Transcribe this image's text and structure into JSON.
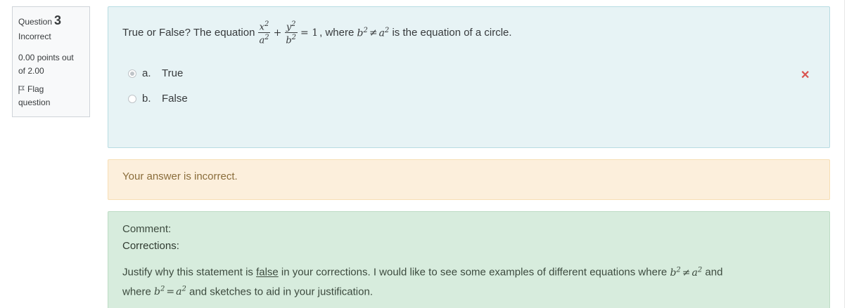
{
  "info": {
    "question_label": "Question",
    "question_number": "3",
    "state": "Incorrect",
    "grade_line1": "0.00 points out",
    "grade_line2": "of 2.00",
    "flag_label": "Flag",
    "flag_label2": "question"
  },
  "question": {
    "prefix": "True or False? The equation",
    "frac1_num": "x",
    "frac1_den": "a",
    "frac2_num": "y",
    "frac2_den": "b",
    "exp": "2",
    "plus": "+",
    "equals_one": "= 1",
    "where": ", where ",
    "b": "b",
    "neq": "≠",
    "a": "a",
    "suffix": " is the equation of a circle."
  },
  "answers": [
    {
      "letter": "a.",
      "text": "True",
      "checked": true
    },
    {
      "letter": "b.",
      "text": "False",
      "checked": false
    }
  ],
  "feedback": {
    "incorrect": "Your answer is incorrect.",
    "comment_label": "Comment:",
    "corrections_label": "Corrections:",
    "body_part1": "Justify why this statement is ",
    "body_false": "false",
    "body_part2": " in your corrections. I would like to see some examples of different equations where ",
    "body_part3": " and",
    "body_line2_start": "where ",
    "eq": "=",
    "body_part4": " and sketches to aid in your justification."
  },
  "colors": {
    "question_bg": "#e7f3f5",
    "incorrect_bg": "#fcefdc",
    "comment_bg": "#d7ecdd",
    "wrong_mark": "#d9534f"
  }
}
